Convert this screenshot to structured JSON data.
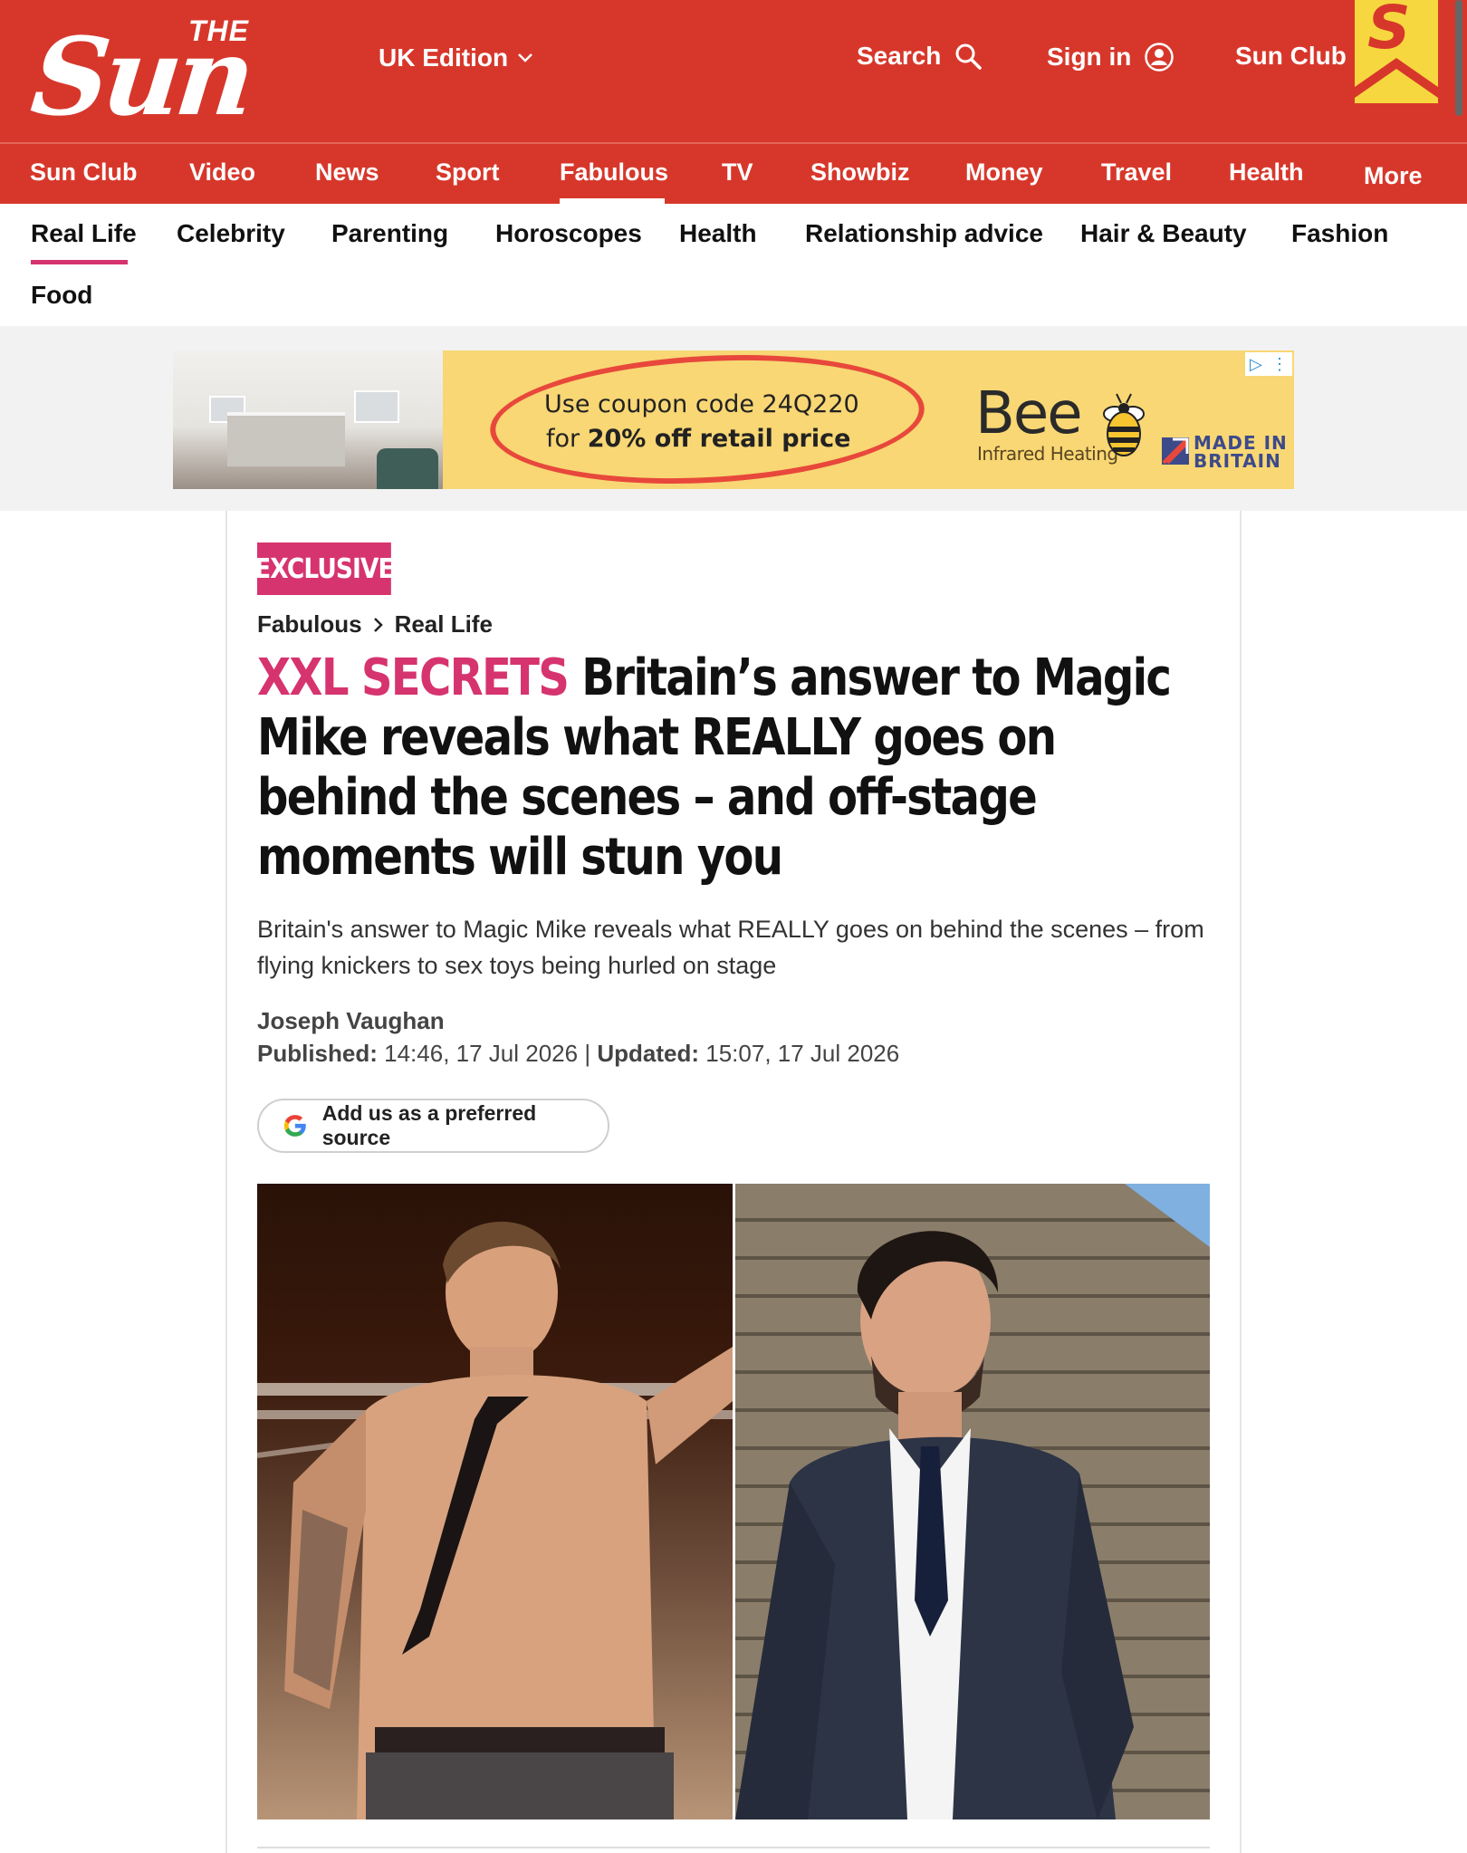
{
  "header": {
    "logo_the": "THE",
    "logo_sun": "Sun",
    "edition_label": "UK Edition",
    "search_label": "Search",
    "signin_label": "Sign in",
    "sunclub_label": "Sun Club",
    "sunclub_badge": "S",
    "brand_red": "#d7372b",
    "badge_yellow": "#f7d73f"
  },
  "primary_nav": [
    "Sun Club",
    "Video",
    "News",
    "Sport",
    "Fabulous",
    "TV",
    "Showbiz",
    "Money",
    "Travel",
    "Health",
    "More"
  ],
  "primary_nav_active": "Fabulous",
  "secondary_nav": [
    "Real Life",
    "Celebrity",
    "Parenting",
    "Horoscopes",
    "Health",
    "Relationship advice",
    "Hair & Beauty",
    "Fashion",
    "Food"
  ],
  "secondary_nav_active": "Real Life",
  "ad": {
    "line1": "Use coupon code 24Q220",
    "line2_pre": "for ",
    "line2_bold": "20% off retail price",
    "brand": "Bee",
    "brand_sub": "Infrared Heating",
    "made_in_1": "MADE IN",
    "made_in_2": "BRITAIN"
  },
  "article": {
    "badge": "EXCLUSIVE",
    "accent": "#d6346e",
    "breadcrumb": [
      "Fabulous",
      "Real Life"
    ],
    "kicker": "XXL SECRETS",
    "headline": "Britain’s answer to Magic Mike reveals what REALLY goes on behind the scenes – and off-stage moments will stun you",
    "standfirst": "Britain's answer to Magic Mike  reveals what REALLY goes on behind the scenes – from flying knickers to sex toys being hurled on stage",
    "author": "Joseph Vaughan",
    "published_label": "Published:",
    "published_value": "14:46, 17 Jul 2026",
    "separator": "|",
    "updated_label": "Updated:",
    "updated_value": "15:07, 17 Jul 2026",
    "preferred_source_label": "Add us as a preferred source"
  }
}
